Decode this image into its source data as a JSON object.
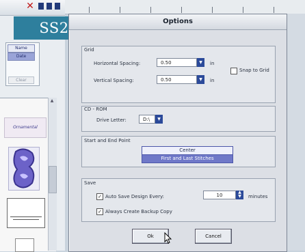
{
  "watermark": "SS2",
  "left_panel": {
    "buttons": [
      "Name",
      "Date"
    ],
    "grey_button": "Clear",
    "scroll_up": "▲",
    "thumb_caption": "Ornamental"
  },
  "dialog": {
    "title": "Options",
    "grid": {
      "label": "Grid",
      "horizontal_label": "Horizontal Spacing:",
      "horizontal_value": "0.50",
      "vertical_label": "Vertical Spacing:",
      "vertical_value": "0.50",
      "unit": "in",
      "snap_label": "Snap to Grid"
    },
    "cdrom": {
      "label": "CD - ROM",
      "drive_label": "Drive Letter:",
      "drive_value": "D:\\"
    },
    "endpoints": {
      "label": "Start and End Point",
      "options": [
        "Center",
        "First and Last Stitches"
      ]
    },
    "save": {
      "label": "Save",
      "autosave_label": "Auto Save Design Every:",
      "autosave_value": "10",
      "autosave_unit": "minutes",
      "backup_label": "Always Create Backup Copy"
    },
    "ok_label": "Ok",
    "cancel_label": "Cancel"
  }
}
